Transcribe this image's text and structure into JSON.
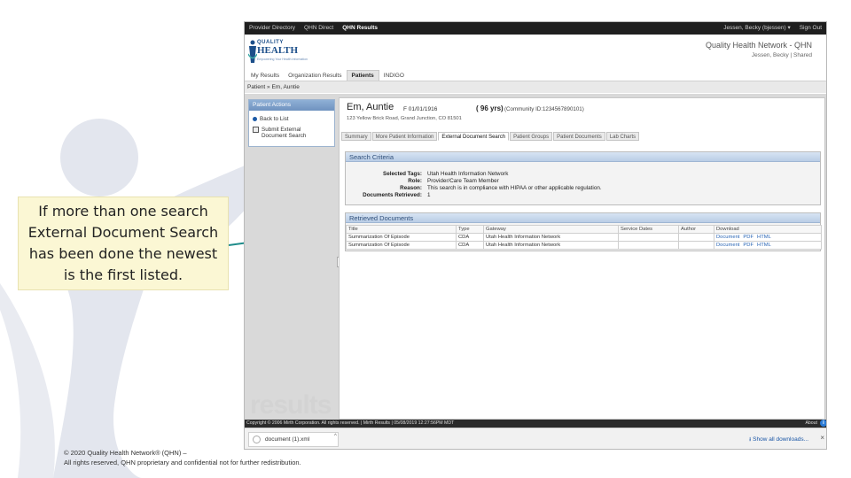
{
  "slide": {
    "callout": "If more than one search External Document Search has been done the newest is the first listed.",
    "copyright_line1": "© 2020 Quality Health Network® (QHN) –",
    "copyright_line2": "All rights reserved, QHN proprietary and confidential not for further redistribution."
  },
  "app": {
    "topnav": {
      "items": [
        "Provider Directory",
        "QHN Direct",
        "QHN Results"
      ],
      "active": "QHN Results",
      "user": "Jessen, Becky (bjessen) ▾",
      "signout": "Sign Out"
    },
    "header": {
      "logo_top": "QUALITY",
      "logo_main": "HEALTH",
      "logo_sub": "Empowering Your Health Information",
      "network": "Quality Health Network - QHN",
      "user_line": "Jessen, Becky | Shared"
    },
    "tabs": [
      "My Results",
      "Organization Results",
      "Patients",
      "INDIGO"
    ],
    "active_tab": "Patients",
    "breadcrumb": "Patient » Em, Auntie",
    "patient_actions": {
      "title": "Patient Actions",
      "back": "Back to List",
      "submit_line1": "Submit External",
      "submit_line2": "Document Search"
    },
    "patient": {
      "name": "Em, Auntie",
      "info": "F    01/01/1916",
      "age": "( 96 yrs)",
      "community": "(Community ID:1234567890101)",
      "address": "123 Yellow Brick Road, Grand Junction, CO  81501"
    },
    "patient_tabs": [
      "Summary",
      "More Patient Information",
      "External Document Search",
      "Patient Groups",
      "Patient Documents",
      "Lab Charts"
    ],
    "active_patient_tab": "External Document Search",
    "search_criteria": {
      "title": "Search Criteria",
      "rows": [
        {
          "k": "Selected Tags:",
          "v": "Utah Health Information Network"
        },
        {
          "k": "Role:",
          "v": "Provider/Care Team Member"
        },
        {
          "k": "Reason:",
          "v": "This search is in compliance with HIPAA or other applicable regulation."
        },
        {
          "k": "Documents Retrieved:",
          "v": "1"
        }
      ]
    },
    "retrieved": {
      "title": "Retrieved Documents",
      "columns": [
        "Title",
        "Type",
        "Gateway",
        "Service Dates",
        "Author",
        "Download"
      ],
      "rows": [
        {
          "title": "Summarization Of Episode",
          "type": "CDA",
          "gateway": "Utah Health Information Network",
          "dates": "",
          "author": ""
        },
        {
          "title": "Summarization Of Episode",
          "type": "CDA",
          "gateway": "Utah Health Information Network",
          "dates": "",
          "author": ""
        }
      ],
      "links": [
        "Document",
        "PDF",
        "HTML"
      ]
    },
    "watermark": "results",
    "footer": "Copyright © 2006 Mirth Corporation. All rights reserved. | Mirth Results | 05/08/2019 12:27:56PM MDT",
    "about": "About",
    "download": {
      "file": "document (1).xml",
      "show_all": "Show all downloads...",
      "close": "×"
    }
  }
}
